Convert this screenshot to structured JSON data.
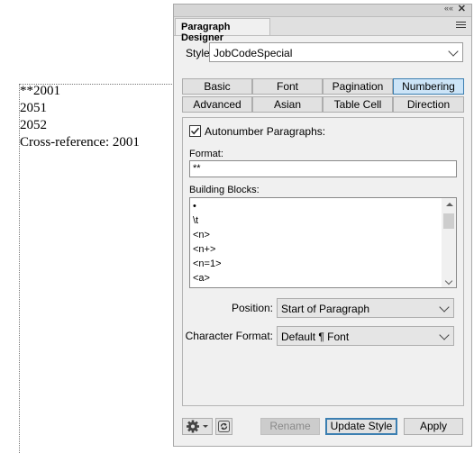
{
  "document": {
    "lines": [
      "**2001",
      "2051",
      "2052",
      "Cross-reference: 2001"
    ]
  },
  "panel": {
    "tab_title": "Paragraph Designer",
    "collapse_glyph": "««",
    "close_glyph": "✕"
  },
  "style": {
    "label": "Style:",
    "value": "JobCodeSpecial"
  },
  "tabs": {
    "row1": [
      "Basic",
      "Font",
      "Pagination",
      "Numbering"
    ],
    "row2": [
      "Advanced",
      "Asian",
      "Table Cell",
      "Direction"
    ],
    "active": "Numbering"
  },
  "numbering": {
    "autonumber_label": "Autonumber Paragraphs:",
    "autonumber_checked": true,
    "format_label": "Format:",
    "format_value": "**",
    "building_blocks_label": "Building Blocks:",
    "building_blocks": [
      "•",
      "\\t",
      "<n>",
      "<n+>",
      "<n=1>",
      "<a>"
    ],
    "position_label": "Position:",
    "position_value": "Start of Paragraph",
    "char_format_label": "Character Format:",
    "char_format_value": "Default ¶ Font"
  },
  "footer": {
    "rename": "Rename",
    "update_style": "Update Style",
    "apply": "Apply",
    "settings_icon": "gear-icon",
    "refresh_icon": "refresh-icon"
  }
}
